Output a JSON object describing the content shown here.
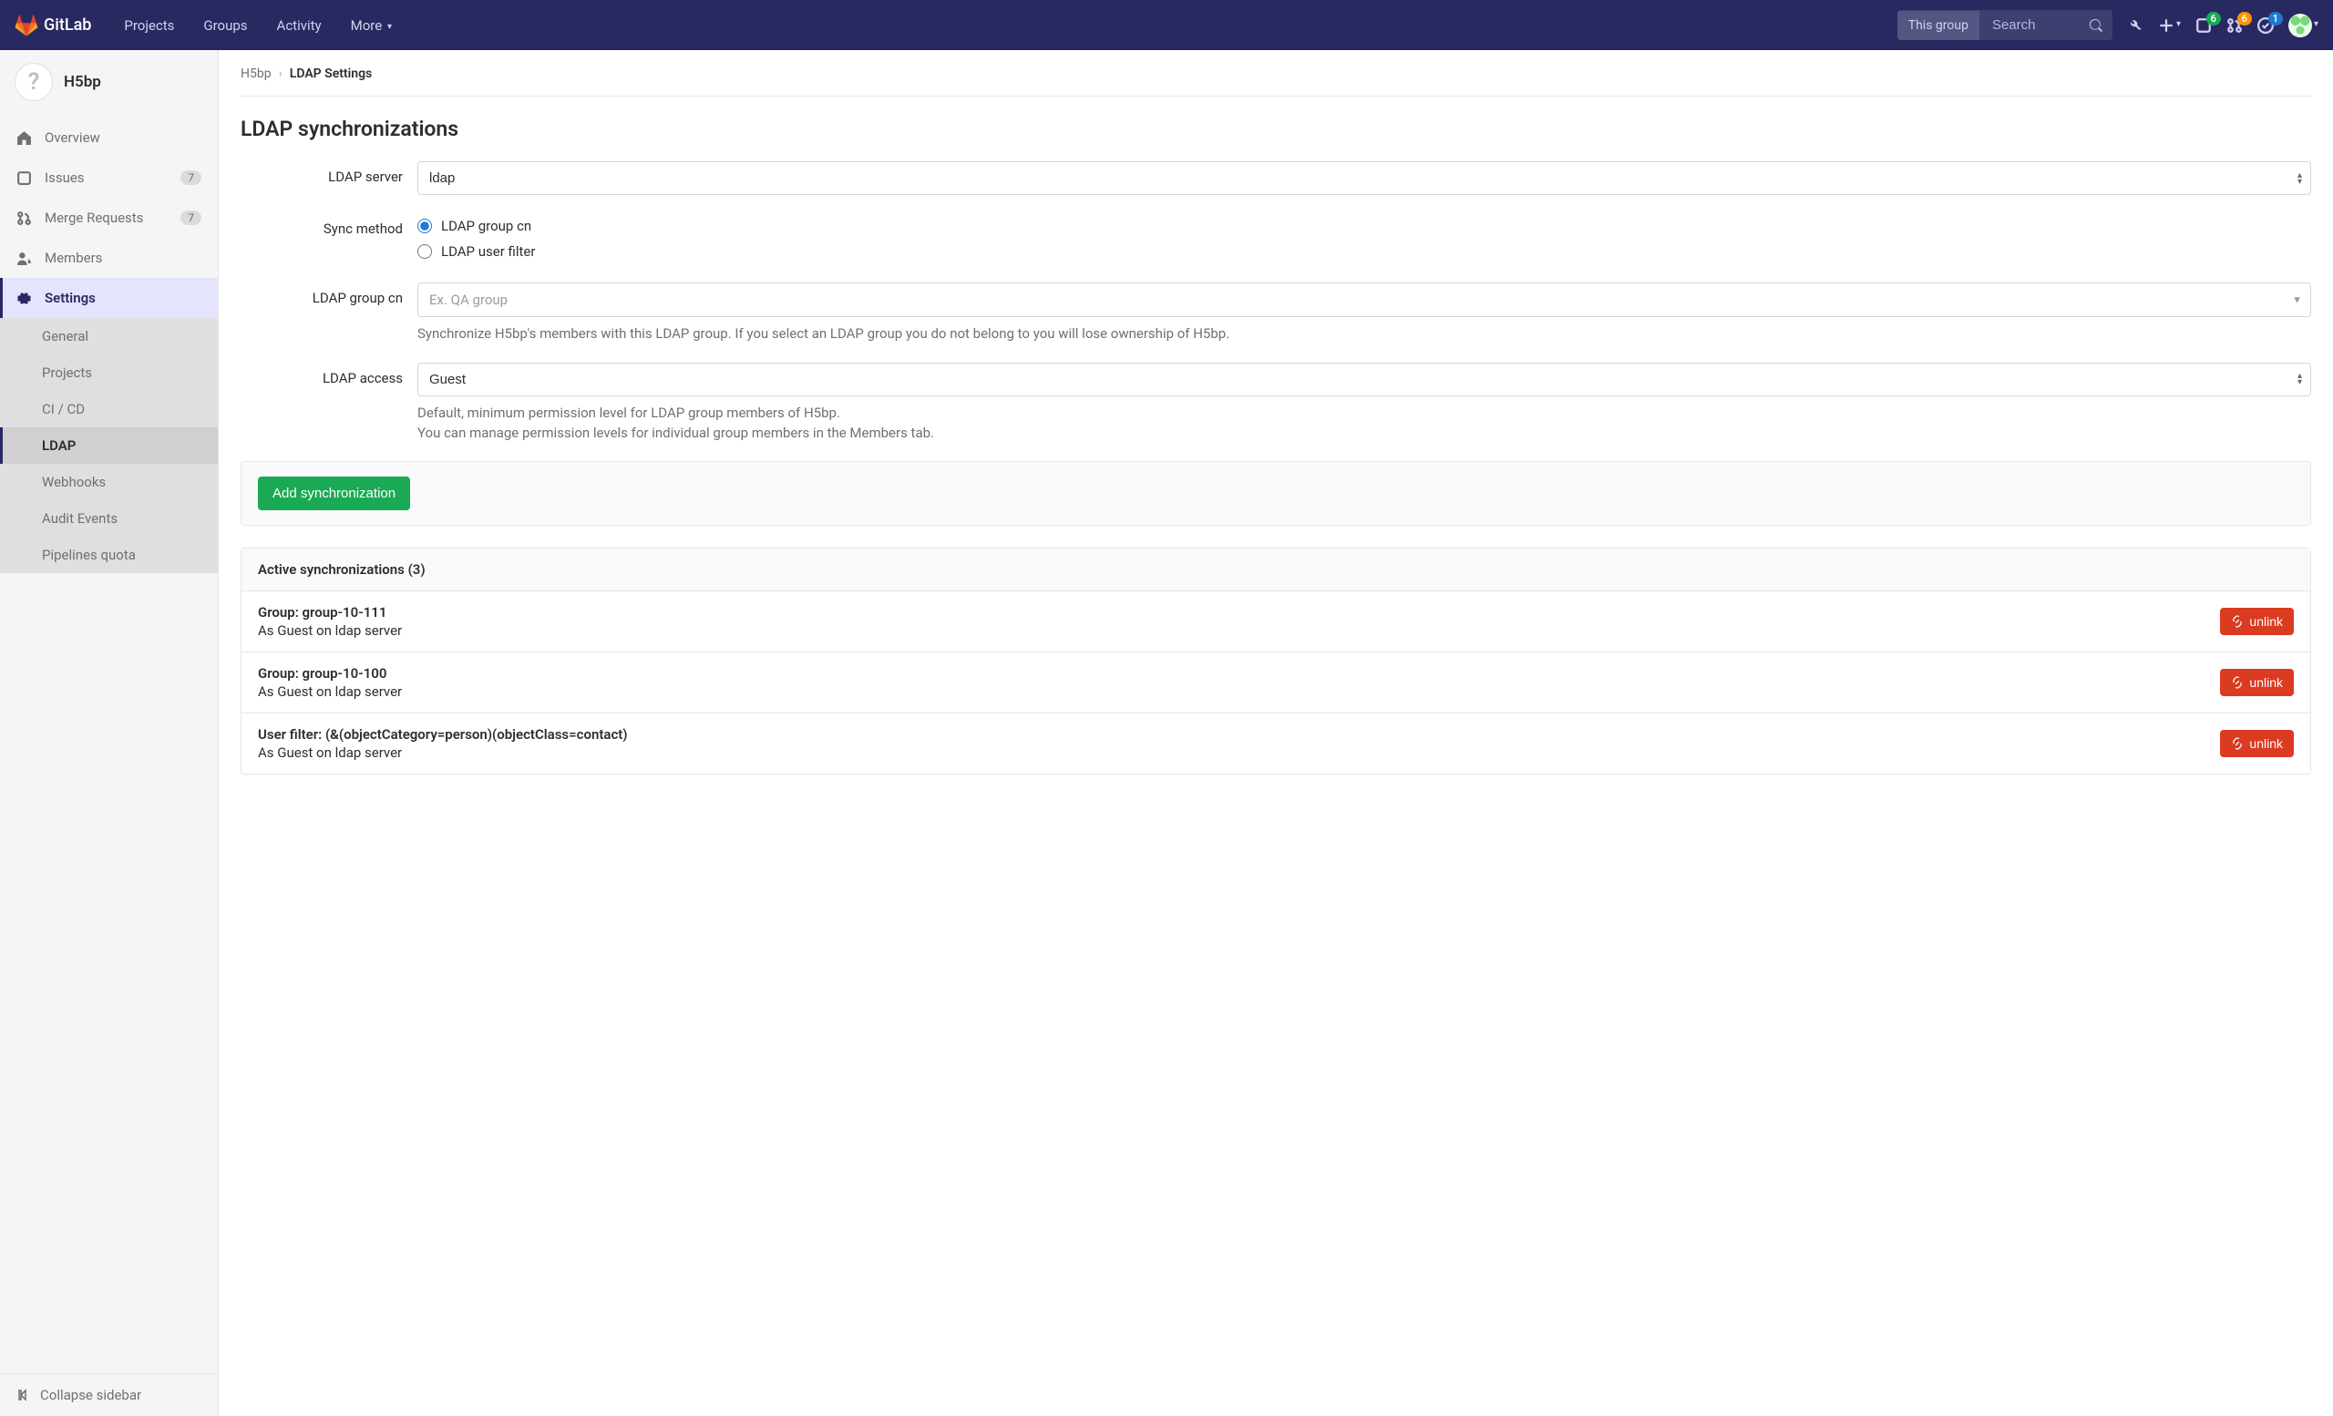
{
  "brand": "GitLab",
  "topnav": {
    "projects": "Projects",
    "groups": "Groups",
    "activity": "Activity",
    "more": "More"
  },
  "search": {
    "scope": "This group",
    "placeholder": "Search"
  },
  "badges": {
    "issues": "6",
    "mrs": "6",
    "todos": "1"
  },
  "sidebar": {
    "project_name": "H5bp",
    "project_initial": "?",
    "items": {
      "overview": "Overview",
      "issues": "Issues",
      "issues_count": "7",
      "merge_requests": "Merge Requests",
      "mr_count": "7",
      "members": "Members",
      "settings": "Settings"
    },
    "sub": {
      "general": "General",
      "projects": "Projects",
      "cicd": "CI / CD",
      "ldap": "LDAP",
      "webhooks": "Webhooks",
      "audit": "Audit Events",
      "pipelines": "Pipelines quota"
    },
    "collapse": "Collapse sidebar"
  },
  "breadcrumb": {
    "root": "H5bp",
    "current": "LDAP Settings"
  },
  "page": {
    "title": "LDAP synchronizations"
  },
  "form": {
    "server_label": "LDAP server",
    "server_value": "ldap",
    "sync_label": "Sync method",
    "sync_opt1": "LDAP group cn",
    "sync_opt2": "LDAP user filter",
    "group_cn_label": "LDAP group cn",
    "group_cn_placeholder": "Ex. QA group",
    "group_cn_help": "Synchronize H5bp's members with this LDAP group. If you select an LDAP group you do not belong to you will lose ownership of H5bp.",
    "access_label": "LDAP access",
    "access_value": "Guest",
    "access_help1": "Default, minimum permission level for LDAP group members of H5bp.",
    "access_help2": "You can manage permission levels for individual group members in the Members tab.",
    "submit": "Add synchronization"
  },
  "syncs": {
    "header": "Active synchronizations (3)",
    "rows": [
      {
        "title": "Group: group-10-111",
        "sub": "As Guest on ldap server"
      },
      {
        "title": "Group: group-10-100",
        "sub": "As Guest on ldap server"
      },
      {
        "title": "User filter: (&(objectCategory=person)(objectClass=contact)",
        "sub": "As Guest on ldap server"
      }
    ],
    "unlink": "unlink"
  }
}
